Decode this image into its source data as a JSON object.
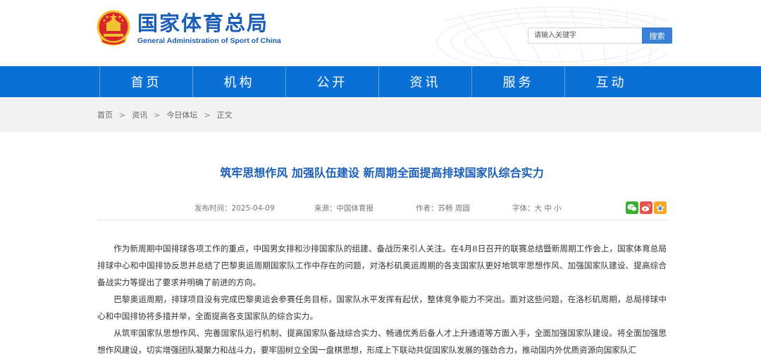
{
  "site": {
    "name_cn": "国家体育总局",
    "name_en": "General Administration of Sport of China"
  },
  "search": {
    "placeholder": "请输入关键字",
    "button_label": "搜索"
  },
  "nav": {
    "items": [
      "首页",
      "机构",
      "公开",
      "资讯",
      "服务",
      "互动"
    ]
  },
  "breadcrumb": [
    "首页",
    "资讯",
    "今日体坛",
    "正文"
  ],
  "breadcrumb_sep": ">",
  "article": {
    "title": "筑牢思想作风 加强队伍建设 新周期全面提高排球国家队综合实力",
    "publish_time": "发布时间：2025-04-09",
    "source": "来源：中国体育报",
    "author": "作者：苏畅 周圆",
    "font_size_label": "字体：大 中 小",
    "paragraphs": [
      "作为新周期中国排球各项工作的重点，中国男女排和沙排国家队的组建、备战历来引人关注。在4月8日召开的联赛总结暨新周期工作会上，国家体育总局排球中心和中国排协反思并总结了巴黎奥运周期国家队工作中存在的问题，对洛杉矶奥运周期的各支国家队更好地筑牢思想作风、加强国家队建设、提高综合备战实力等提出了要求并明确了前进的方向。",
      "巴黎奥运周期，排球项目没有完成巴黎奥运会参赛任务目标，国家队水平发挥有起伏，整体竞争能力不突出。面对这些问题，在洛杉矶周期，总局排球中心和中国排协将多措并举，全面提高各支国家队的综合实力。",
      "从筑牢国家队思想作风、完善国家队运行机制、提高国家队备战综合实力、畅通优秀后备人才上升通道等方面入手，全面加强国家队建设。将全面加强思想作风建设，切实增强团队凝聚力和战斗力，要牢固树立全国一盘棋思想，形成上下联动共促国家队发展的强劲合力，推动国内外优质资源向国家队汇"
    ]
  },
  "share": {
    "icons": [
      "wechat-icon",
      "weibo-icon",
      "qzone-icon"
    ],
    "colors": [
      "#3cb034",
      "#e8544d",
      "#f3a82a"
    ]
  },
  "colors": {
    "brand": "#1a5eb8",
    "nav": "#0b70d5",
    "search_button": "#3a7fd6"
  }
}
